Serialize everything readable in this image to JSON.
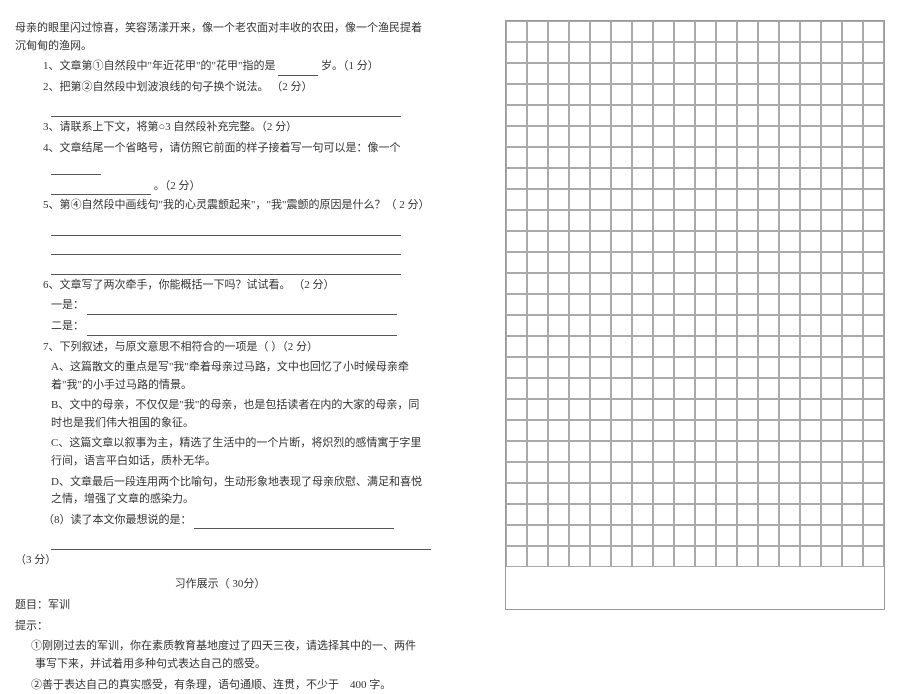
{
  "intro": "母亲的眼里闪过惊喜，笑容荡漾开来，像一个老农面对丰收的农田，像一个渔民提着沉甸甸的渔网。",
  "q1": "1、文章第①自然段中\"年近花甲\"的\"花甲\"指的是",
  "q1_suffix": "岁。（1 分）",
  "q2": "2、把第②自然段中划波浪线的句子换个说法。  （2 分）",
  "q3": "3、请联系上下文，将第○3 自然段补充完整。（2 分）",
  "q4": "4、文章结尾一个省略号，请仿照它前面的样子接着写一句可以是：像一个",
  "q4_suffix": "。（2 分）",
  "q5": "5、第④自然段中画线句\"我的心灵震颤起来\"，\"我\"震颤的原因是什么？（  2 分）",
  "q6": "6、文章写了两次牵手，你能概括一下吗？试试看。  （2 分）",
  "q6_a": "一是：",
  "q6_b": "二是：",
  "q7": "7、下列叙述，与原文意思不相符合的一项是（         ）（2 分）",
  "optA": "A、这篇散文的重点是写\"我\"牵着母亲过马路，文中也回忆了小时候母亲牵着\"我\"的小手过马路的情景。",
  "optB": "B、文中的母亲，不仅仅是\"我\"的母亲，也是包括读者在内的大家的母亲，同时也是我们伟大祖国的象征。",
  "optC": "C、这篇文章以叙事为主，精选了生活中的一个片断，将炽烈的感情寓于字里行间，语言平白如话，质朴无华。",
  "optD": "D、文章最后一段连用两个比喻句，生动形象地表现了母亲欣慰、满足和喜悦之情，增强了文章的感染力。",
  "q8": "（8）读了本文你最想说的是：",
  "q8_score": "（3 分）",
  "section_title": "习作展示（ 30分）",
  "essay_topic_label": "题目：",
  "essay_topic": "军训",
  "tips_label": "提示：",
  "tip1": "①刚刚过去的军训，你在素质教育基地度过了四天三夜，请选择其中的一、两件事写下来，并试着用多种句式表达自己的感受。",
  "tip2": "②善于表达自己的真实感受，有条理，语句通顺、连贯，不少于",
  "tip2_count": "400 字。"
}
